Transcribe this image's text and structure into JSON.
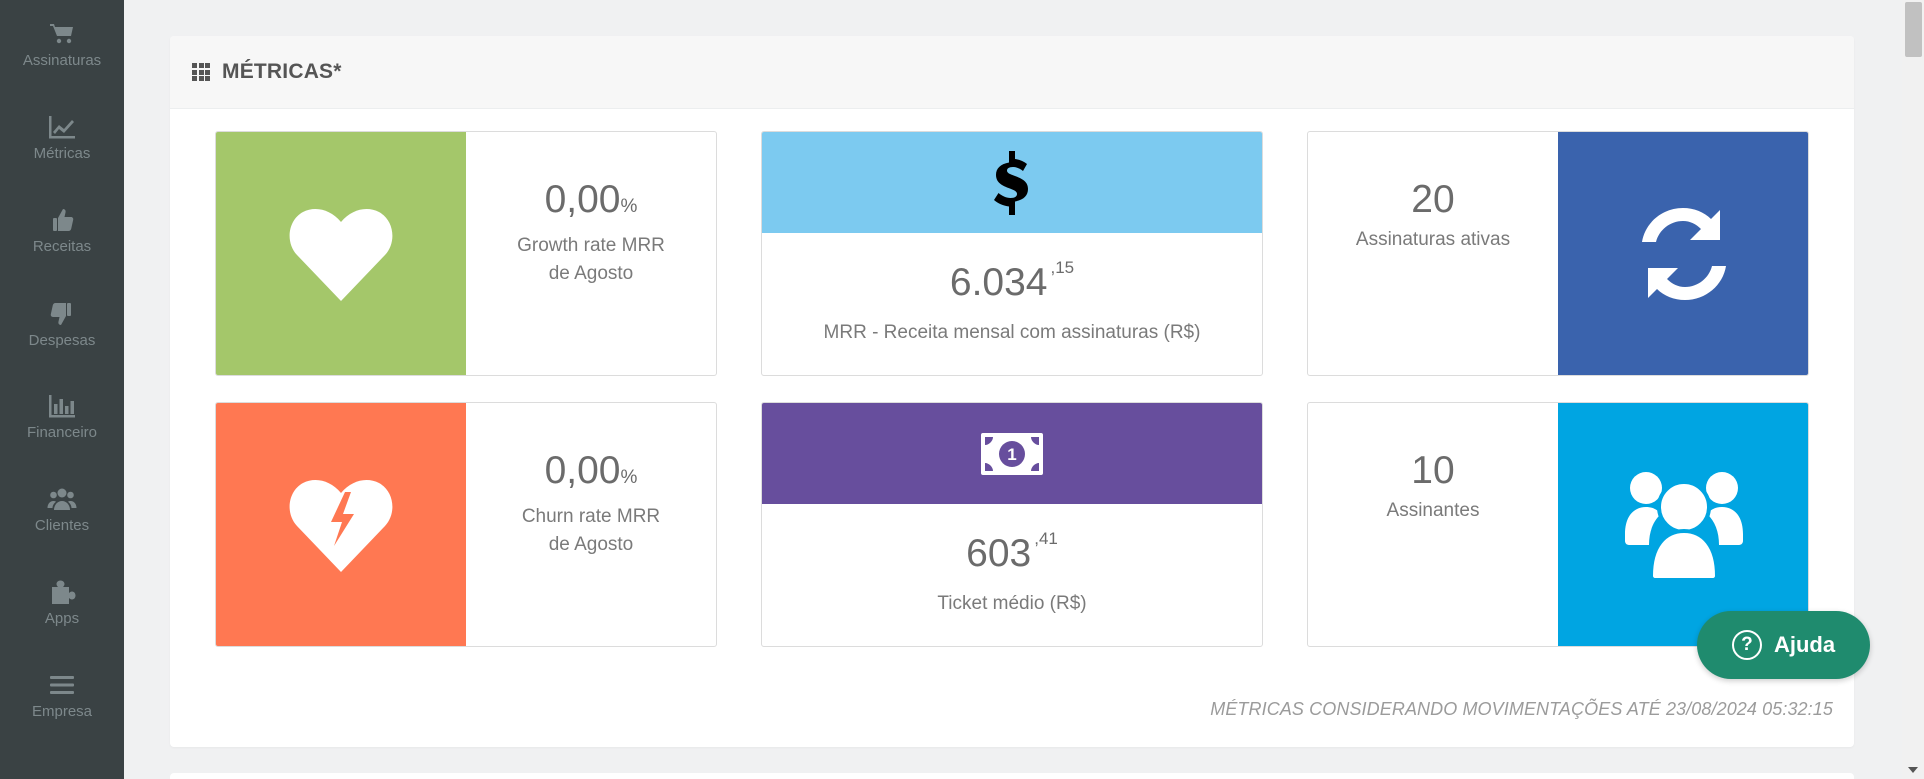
{
  "sidebar": {
    "items": [
      {
        "label": "Assinaturas",
        "icon": "cart-icon"
      },
      {
        "label": "Métricas",
        "icon": "line-chart-icon"
      },
      {
        "label": "Receitas",
        "icon": "thumbs-up-icon"
      },
      {
        "label": "Despesas",
        "icon": "thumbs-down-icon"
      },
      {
        "label": "Financeiro",
        "icon": "bar-chart-icon"
      },
      {
        "label": "Clientes",
        "icon": "users-icon"
      },
      {
        "label": "Apps",
        "icon": "puzzle-icon"
      },
      {
        "label": "Empresa",
        "icon": "menu-icon"
      }
    ]
  },
  "panel": {
    "title": "MÉTRICAS*",
    "footnote": "MÉTRICAS CONSIDERANDO MOVIMENTAÇÕES ATÉ 23/08/2024 05:32:15"
  },
  "cards": {
    "growth": {
      "value": "0,00",
      "unit": "%",
      "label_line1": "Growth rate MRR",
      "label_line2": "de Agosto",
      "color": "#a4c76a",
      "icon": "heart-icon"
    },
    "mrr": {
      "value": "6.034",
      "cents": ",15",
      "label": "MRR - Receita mensal com assinaturas (R$)",
      "color": "#7ccaf0",
      "icon": "dollar-icon"
    },
    "active": {
      "value": "20",
      "label": "Assinaturas ativas",
      "color": "#3a63ad",
      "icon": "refresh-icon"
    },
    "churn": {
      "value": "0,00",
      "unit": "%",
      "label_line1": "Churn rate MRR",
      "label_line2": "de Agosto",
      "color": "#ff7852",
      "icon": "broken-heart-icon"
    },
    "ticket": {
      "value": "603",
      "cents": ",41",
      "label": "Ticket médio (R$)",
      "color": "#674e9d",
      "icon": "money-bill-icon"
    },
    "subscribers": {
      "value": "10",
      "label": "Assinantes",
      "color": "#00a5e2",
      "icon": "users-group-icon"
    }
  },
  "help": {
    "label": "Ajuda",
    "icon_glyph": "?",
    "color": "#1f8b6e"
  }
}
